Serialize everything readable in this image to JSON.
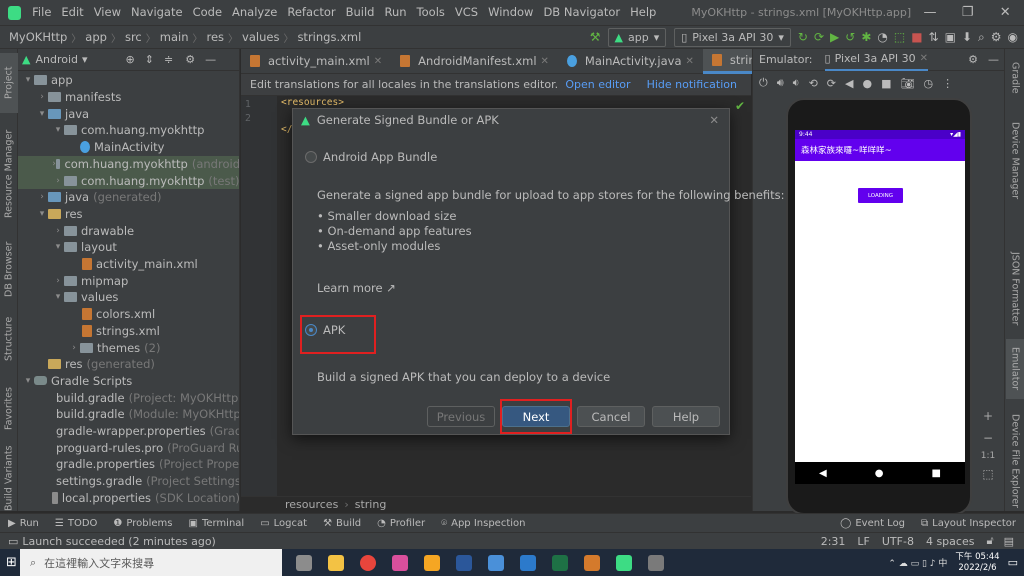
{
  "menubar": {
    "items": [
      "File",
      "Edit",
      "View",
      "Navigate",
      "Code",
      "Analyze",
      "Refactor",
      "Build",
      "Run",
      "Tools",
      "VCS",
      "Window",
      "DB Navigator",
      "Help"
    ],
    "window_title": "MyOKHttp - strings.xml [MyOKHttp.app]"
  },
  "navbar": {
    "breadcrumbs": [
      "MyOKHttp",
      "app",
      "src",
      "main",
      "res",
      "values",
      "strings.xml"
    ],
    "run_config": "app",
    "device": "Pixel 3a API 30"
  },
  "left_strip": [
    "Project",
    "Resource Manager",
    "DB Browser",
    "Structure",
    "Favorites",
    "Build Variants"
  ],
  "right_strip": [
    "Gradle",
    "Device Manager",
    "JSON Formatter",
    "Emulator",
    "Device File Explorer"
  ],
  "project": {
    "view_label": "Android",
    "tree": [
      {
        "label": "app",
        "extra": ""
      },
      {
        "label": "manifests",
        "extra": ""
      },
      {
        "label": "java",
        "extra": ""
      },
      {
        "label": "com.huang.myokhttp",
        "extra": ""
      },
      {
        "label": "MainActivity",
        "extra": ""
      },
      {
        "label": "com.huang.myokhttp",
        "extra": "(android"
      },
      {
        "label": "com.huang.myokhttp",
        "extra": "(test)"
      },
      {
        "label": "java",
        "extra": "(generated)"
      },
      {
        "label": "res",
        "extra": ""
      },
      {
        "label": "drawable",
        "extra": ""
      },
      {
        "label": "layout",
        "extra": ""
      },
      {
        "label": "activity_main.xml",
        "extra": ""
      },
      {
        "label": "mipmap",
        "extra": ""
      },
      {
        "label": "values",
        "extra": ""
      },
      {
        "label": "colors.xml",
        "extra": ""
      },
      {
        "label": "strings.xml",
        "extra": ""
      },
      {
        "label": "themes",
        "extra": "(2)"
      },
      {
        "label": "res",
        "extra": "(generated)"
      },
      {
        "label": "Gradle Scripts",
        "extra": ""
      },
      {
        "label": "build.gradle",
        "extra": "(Project: MyOKHttp)"
      },
      {
        "label": "build.gradle",
        "extra": "(Module: MyOKHttp.a"
      },
      {
        "label": "gradle-wrapper.properties",
        "extra": "(Gradle"
      },
      {
        "label": "proguard-rules.pro",
        "extra": "(ProGuard Rul"
      },
      {
        "label": "gradle.properties",
        "extra": "(Project Properti"
      },
      {
        "label": "settings.gradle",
        "extra": "(Project Settings)"
      },
      {
        "label": "local.properties",
        "extra": "(SDK Location)"
      }
    ]
  },
  "editor": {
    "tabs": [
      "activity_main.xml",
      "AndroidManifest.xml",
      "MainActivity.java",
      "strings.xml"
    ],
    "notice": "Edit translations for all locales in the translations editor.",
    "open_editor": "Open editor",
    "hide_notification": "Hide notification",
    "lines": [
      "1",
      "2"
    ],
    "code_line1": "<resources>",
    "code_line2": "</",
    "footer_crumbs": [
      "resources",
      "string"
    ]
  },
  "emulator": {
    "label": "Emulator:",
    "device_tab": "Pixel 3a API 30",
    "status_time": "9:44",
    "app_title": "森林家族來囉~咩咩咩~",
    "button_label": "LOADING",
    "zoom_ratio": "1:1"
  },
  "dialog": {
    "title": "Generate Signed Bundle or APK",
    "option1": "Android App Bundle",
    "description": "Generate a signed app bundle for upload to app stores for the following benefits:",
    "benefits": [
      "• Smaller download size",
      "• On-demand app features",
      "• Asset-only modules"
    ],
    "learn_more": "Learn more ↗",
    "option2": "APK",
    "apk_description": "Build a signed APK that you can deploy to a device",
    "buttons": {
      "previous": "Previous",
      "next": "Next",
      "cancel": "Cancel",
      "help": "Help"
    },
    "selected": "APK"
  },
  "bottom_tools": {
    "left": [
      "Run",
      "TODO",
      "Problems",
      "Terminal",
      "Logcat",
      "Build",
      "Profiler",
      "App Inspection"
    ],
    "right": [
      "Event Log",
      "Layout Inspector"
    ]
  },
  "statusbar": {
    "message": "Launch succeeded (2 minutes ago)",
    "position": "2:31",
    "line_sep": "LF",
    "encoding": "UTF-8",
    "indent": "4 spaces"
  },
  "taskbar": {
    "search_placeholder": "在這裡輸入文字來搜尋",
    "time": "下午 05:44",
    "date": "2022/2/6"
  },
  "colors": {
    "accent": "#4a88c7",
    "emulator_app": "#6200ee",
    "highlight": "#e02020"
  }
}
